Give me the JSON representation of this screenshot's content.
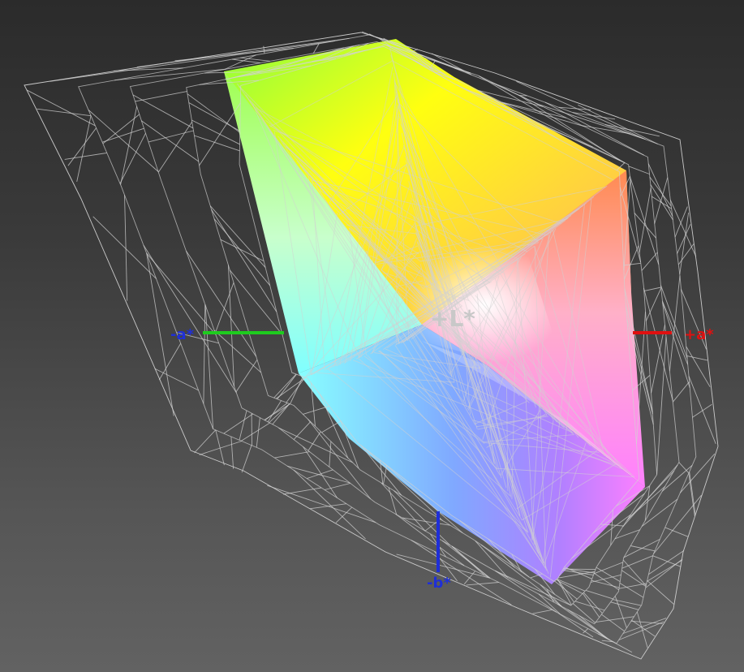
{
  "axes": {
    "l_plus": {
      "label": "+L*",
      "color": "#c8c8c8"
    },
    "a_plus": {
      "label": "+a*",
      "color": "#e01010"
    },
    "a_minus": {
      "label": "-a*",
      "color": "#1f2fd8"
    },
    "b_minus": {
      "label": "-b*",
      "color": "#1f2fd8"
    },
    "a_minus_line_color": "#1ecc1e",
    "b_minus_line_color": "#1f2fd8"
  },
  "colors": {
    "wireframe": "#d2d2d2",
    "solid_gamut_yellow": "#ffff10",
    "solid_gamut_green": "#88ff44",
    "solid_gamut_cyan": "#88ffff",
    "solid_gamut_blue": "#6f8cff",
    "solid_gamut_violet": "#b477ff",
    "solid_gamut_magenta": "#ff77ff",
    "solid_gamut_orange": "#ff8a40",
    "solid_gamut_white": "#ffffff"
  }
}
